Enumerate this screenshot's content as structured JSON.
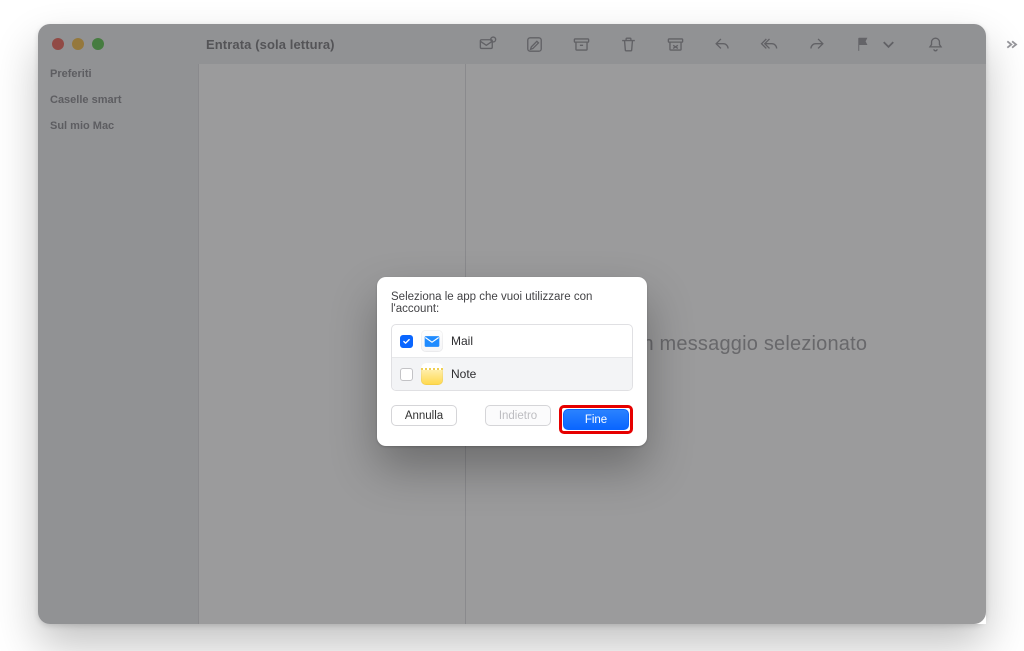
{
  "window": {
    "title": "Entrata (sola lettura)"
  },
  "sidebar": {
    "groups": [
      "Preferiti",
      "Caselle smart",
      "Sul mio Mac"
    ]
  },
  "placeholder": "Nessun messaggio selezionato",
  "modal": {
    "heading": "Seleziona le app che vuoi utilizzare con l'account:",
    "options": {
      "0": {
        "label": "Mail"
      },
      "1": {
        "label": "Note"
      }
    },
    "buttons": {
      "cancel": "Annulla",
      "back": "Indietro",
      "done": "Fine"
    }
  }
}
